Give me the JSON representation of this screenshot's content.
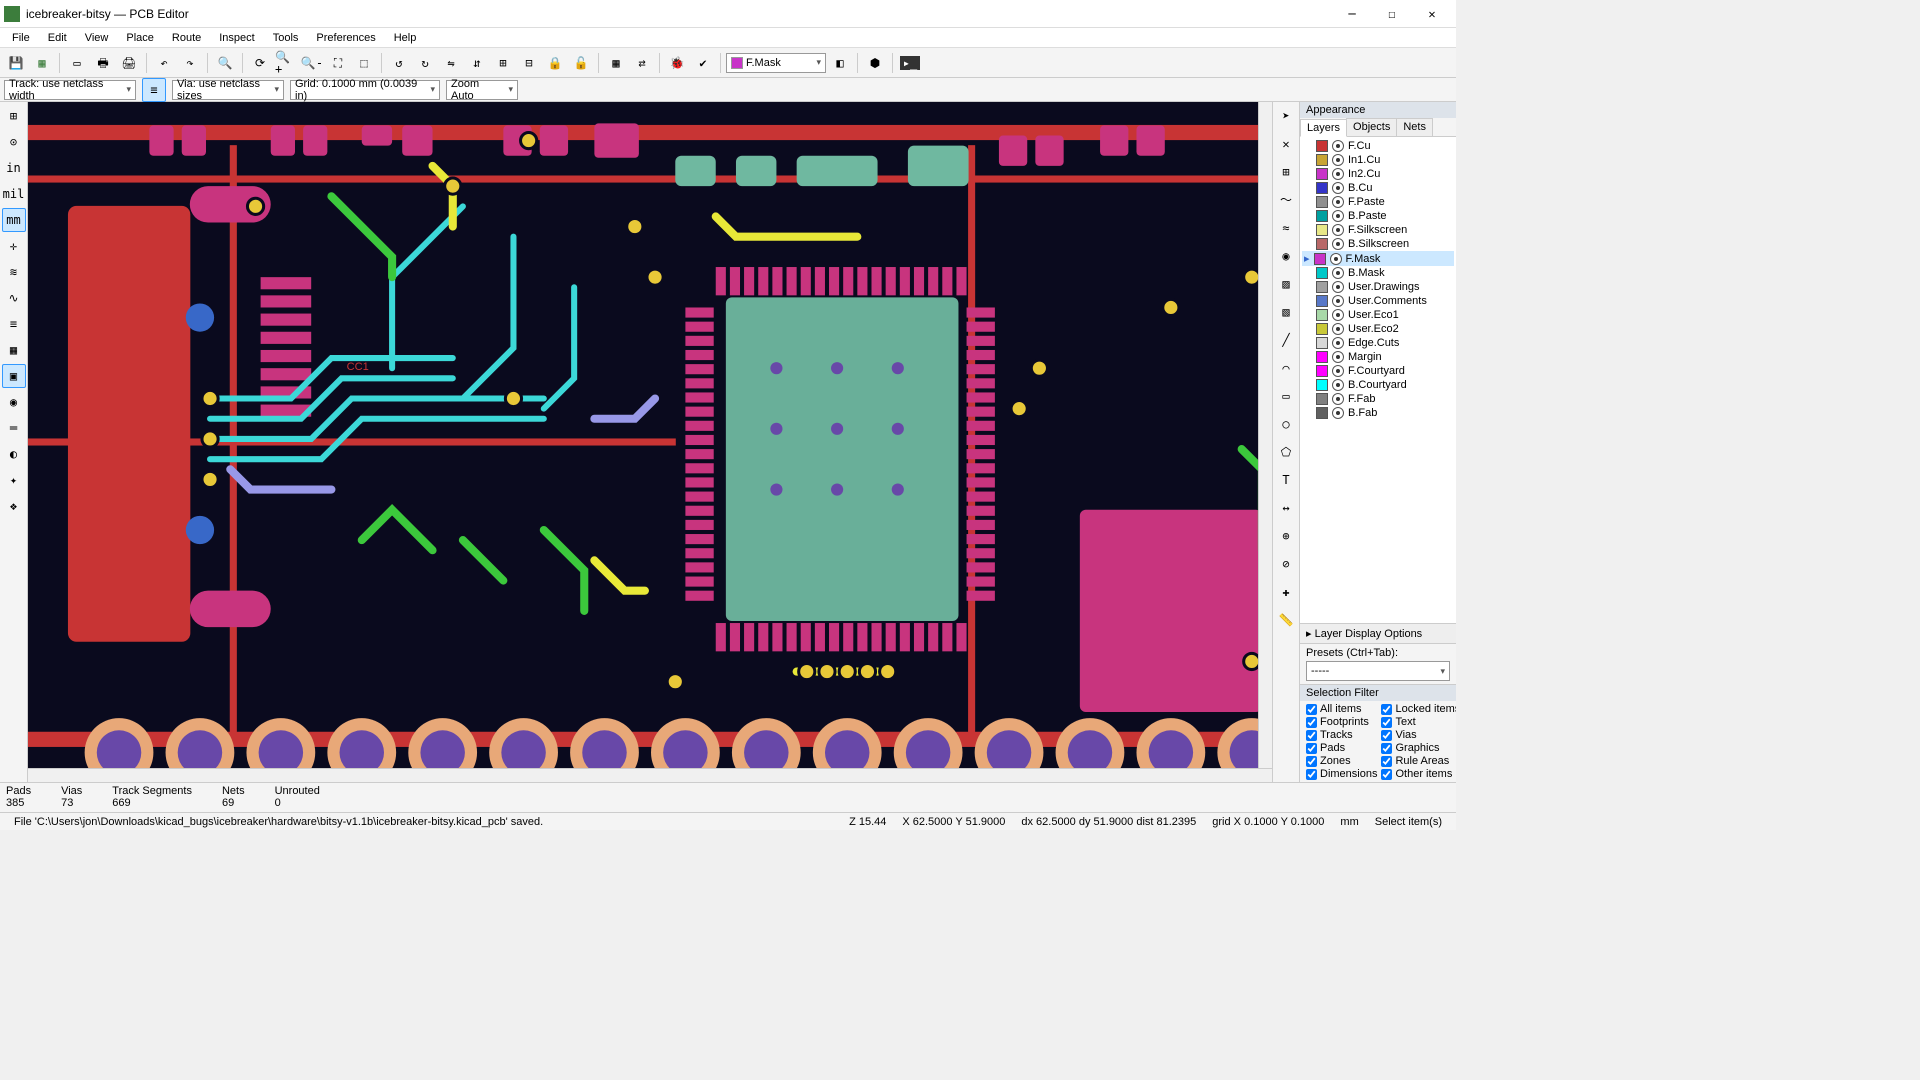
{
  "window": {
    "title": "icebreaker-bitsy — PCB Editor"
  },
  "menu": [
    "File",
    "Edit",
    "View",
    "Place",
    "Route",
    "Inspect",
    "Tools",
    "Preferences",
    "Help"
  ],
  "layer_dropdown": "F.Mask",
  "options": {
    "track": "Track: use netclass width",
    "via": "Via: use netclass sizes",
    "grid": "Grid: 0.1000 mm (0.0039 in)",
    "zoom": "Zoom Auto"
  },
  "left_tools": [
    {
      "name": "grid-toggle",
      "glyph": "⊞",
      "t": false
    },
    {
      "name": "polar-coord",
      "glyph": "⊙",
      "t": false
    },
    {
      "name": "inches-unit",
      "glyph": "in",
      "t": false
    },
    {
      "name": "mils-unit",
      "glyph": "mil",
      "t": false
    },
    {
      "name": "mm-unit",
      "glyph": "mm",
      "t": true
    },
    {
      "name": "cursor-shape",
      "glyph": "✛",
      "t": false
    },
    {
      "name": "ratsnest-toggle",
      "glyph": "≋",
      "t": false
    },
    {
      "name": "ratsnest-curved",
      "glyph": "∿",
      "t": false
    },
    {
      "name": "net-highlight",
      "glyph": "≡",
      "t": false
    },
    {
      "name": "zone-display",
      "glyph": "▦",
      "t": false
    },
    {
      "name": "pad-display",
      "glyph": "▣",
      "t": true
    },
    {
      "name": "via-display",
      "glyph": "◉",
      "t": false
    },
    {
      "name": "track-display",
      "glyph": "═",
      "t": false
    },
    {
      "name": "contrast-mode",
      "glyph": "◐",
      "t": false
    },
    {
      "name": "layer-alpha",
      "glyph": "✦",
      "t": false
    },
    {
      "name": "layer-manager",
      "glyph": "❖",
      "t": false
    }
  ],
  "right_tools": [
    {
      "name": "select-tool",
      "glyph": "➤"
    },
    {
      "name": "highlight-net",
      "glyph": "✕"
    },
    {
      "name": "display-grid",
      "glyph": "⊞"
    },
    {
      "name": "route-track",
      "glyph": "〜"
    },
    {
      "name": "route-diff",
      "glyph": "≈"
    },
    {
      "name": "add-via",
      "glyph": "◉"
    },
    {
      "name": "add-zone",
      "glyph": "▨"
    },
    {
      "name": "add-ruleset",
      "glyph": "▧"
    },
    {
      "name": "draw-line",
      "glyph": "╱"
    },
    {
      "name": "draw-arc",
      "glyph": "⌒"
    },
    {
      "name": "draw-rect",
      "glyph": "▭"
    },
    {
      "name": "draw-circle",
      "glyph": "○"
    },
    {
      "name": "draw-poly",
      "glyph": "⬠"
    },
    {
      "name": "add-text",
      "glyph": "T"
    },
    {
      "name": "add-dimension",
      "glyph": "↔"
    },
    {
      "name": "set-origin",
      "glyph": "⊕"
    },
    {
      "name": "delete-tool",
      "glyph": "⊘"
    },
    {
      "name": "anchor-tool",
      "glyph": "✚"
    },
    {
      "name": "measure-tool",
      "glyph": "📏"
    }
  ],
  "appearance": {
    "title": "Appearance",
    "tabs": [
      "Layers",
      "Objects",
      "Nets"
    ],
    "active_tab": 0,
    "layers": [
      {
        "name": "F.Cu",
        "color": "#c83434"
      },
      {
        "name": "In1.Cu",
        "color": "#c8a434"
      },
      {
        "name": "In2.Cu",
        "color": "#c834c8"
      },
      {
        "name": "B.Cu",
        "color": "#3434c8"
      },
      {
        "name": "F.Paste",
        "color": "#909090"
      },
      {
        "name": "B.Paste",
        "color": "#00a0a0"
      },
      {
        "name": "F.Silkscreen",
        "color": "#e8e888"
      },
      {
        "name": "B.Silkscreen",
        "color": "#b86868"
      },
      {
        "name": "F.Mask",
        "color": "#c834c8",
        "sel": true
      },
      {
        "name": "B.Mask",
        "color": "#00c8c8"
      },
      {
        "name": "User.Drawings",
        "color": "#a0a0a0"
      },
      {
        "name": "User.Comments",
        "color": "#5878c8"
      },
      {
        "name": "User.Eco1",
        "color": "#a8d8a8"
      },
      {
        "name": "User.Eco2",
        "color": "#c8c838"
      },
      {
        "name": "Edge.Cuts",
        "color": "#d8d8d8"
      },
      {
        "name": "Margin",
        "color": "#ff00ff"
      },
      {
        "name": "F.Courtyard",
        "color": "#ff00ff"
      },
      {
        "name": "B.Courtyard",
        "color": "#00ffff"
      },
      {
        "name": "F.Fab",
        "color": "#808080"
      },
      {
        "name": "B.Fab",
        "color": "#606060"
      }
    ],
    "layer_opts": "Layer Display Options",
    "presets_label": "Presets (Ctrl+Tab):",
    "presets_value": "-----"
  },
  "selection_filter": {
    "title": "Selection Filter",
    "items_left": [
      "All items",
      "Footprints",
      "Tracks",
      "Pads",
      "Zones",
      "Dimensions"
    ],
    "items_right": [
      "Locked items",
      "Text",
      "Vias",
      "Graphics",
      "Rule Areas",
      "Other items"
    ]
  },
  "stats": {
    "pads_l": "Pads",
    "pads_v": "385",
    "vias_l": "Vias",
    "vias_v": "73",
    "ts_l": "Track Segments",
    "ts_v": "669",
    "nets_l": "Nets",
    "nets_v": "69",
    "unr_l": "Unrouted",
    "unr_v": "0"
  },
  "status": {
    "msg": "File 'C:\\Users\\jon\\Downloads\\kicad_bugs\\icebreaker\\hardware\\bitsy-v1.1b\\icebreaker-bitsy.kicad_pcb' saved.",
    "z": "Z 15.44",
    "xy": "X 62.5000  Y 51.9000",
    "dxy": "dx 62.5000  dy 51.9000  dist 81.2395",
    "grid": "grid X 0.1000  Y 0.1000",
    "unit": "mm",
    "hint": "Select item(s)"
  },
  "pcb_label": "CC1"
}
